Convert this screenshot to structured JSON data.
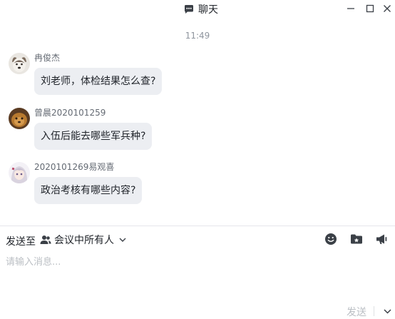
{
  "window": {
    "title": "聊天",
    "controls": [
      "minimize",
      "maximize",
      "close"
    ]
  },
  "chat": {
    "timestamp": "11:49",
    "messages": [
      {
        "sender": "冉俊杰",
        "text": "刘老师，体检结果怎么查?",
        "avatar": "dog-avatar"
      },
      {
        "sender": "曾晨2020101259",
        "text": "入伍后能去哪些军兵种?",
        "avatar": "pet-avatar"
      },
      {
        "sender": "2020101269易观喜",
        "text": "政治考核有哪些内容?",
        "avatar": "anime-girl-avatar"
      }
    ]
  },
  "composer": {
    "send_to_label": "发送至",
    "send_to_target": "会议中所有人",
    "placeholder": "请输入消息...",
    "send_label": "发送",
    "tools": [
      "emoji-icon",
      "folder-icon",
      "megaphone-icon"
    ]
  },
  "colors": {
    "bubble": "#eceef2",
    "text": "#1f2329",
    "muted": "#8f959e",
    "placeholder": "#bbbfc4",
    "icon": "#3b4047"
  }
}
